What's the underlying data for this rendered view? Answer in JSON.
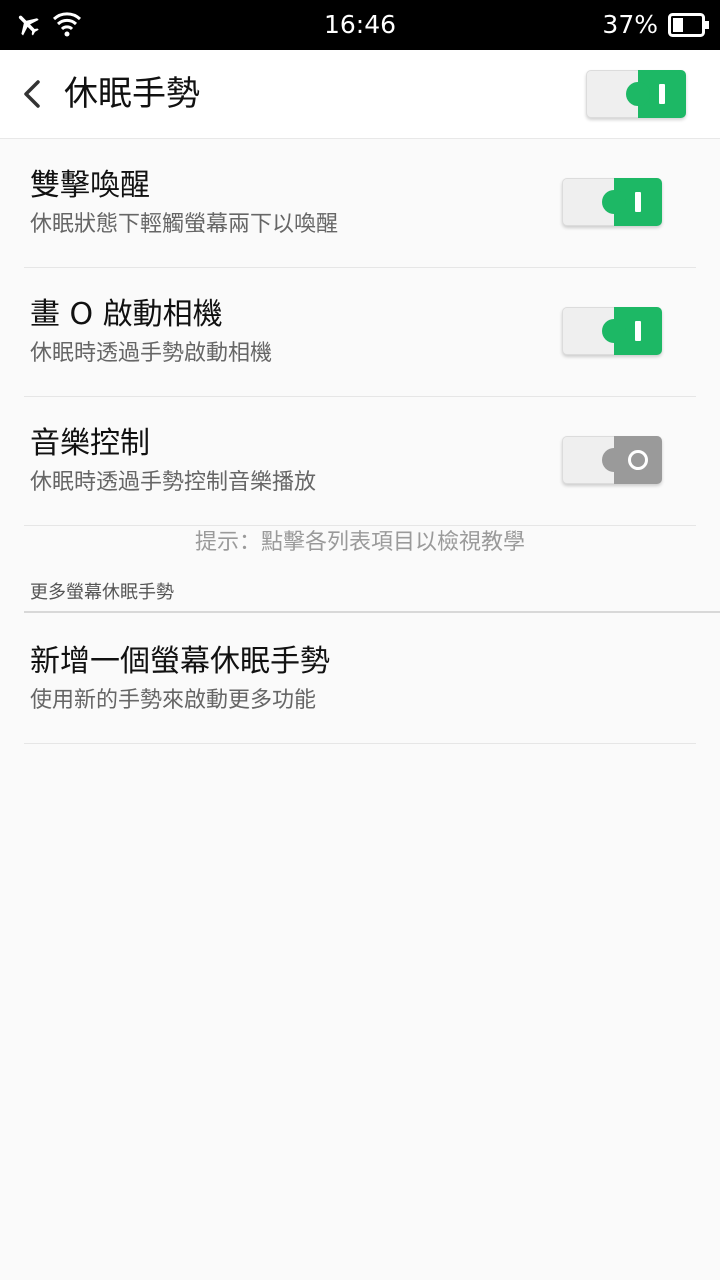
{
  "status_bar": {
    "time": "16:46",
    "battery_percent": "37%",
    "battery_level": 0.37,
    "airplane_icon": "airplane-icon",
    "wifi_icon": "wifi-icon",
    "battery_icon": "battery-icon"
  },
  "header": {
    "title": "休眠手勢",
    "back_icon": "chevron-left-icon",
    "master_toggle_on": true
  },
  "settings": [
    {
      "title": "雙擊喚醒",
      "subtitle": "休眠狀態下輕觸螢幕兩下以喚醒",
      "enabled": true
    },
    {
      "title": "畫 O 啟動相機",
      "subtitle": "休眠時透過手勢啟動相機",
      "enabled": true
    },
    {
      "title": "音樂控制",
      "subtitle": "休眠時透過手勢控制音樂播放",
      "enabled": false
    }
  ],
  "hint": "提示：點擊各列表項目以檢視教學",
  "more_section": {
    "header": "更多螢幕休眠手勢",
    "add_item": {
      "title": "新增一個螢幕休眠手勢",
      "subtitle": "使用新的手勢來啟動更多功能"
    }
  },
  "colors": {
    "toggle_on": "#1db865",
    "toggle_off": "#9a9a9a",
    "background": "#fafafa"
  }
}
